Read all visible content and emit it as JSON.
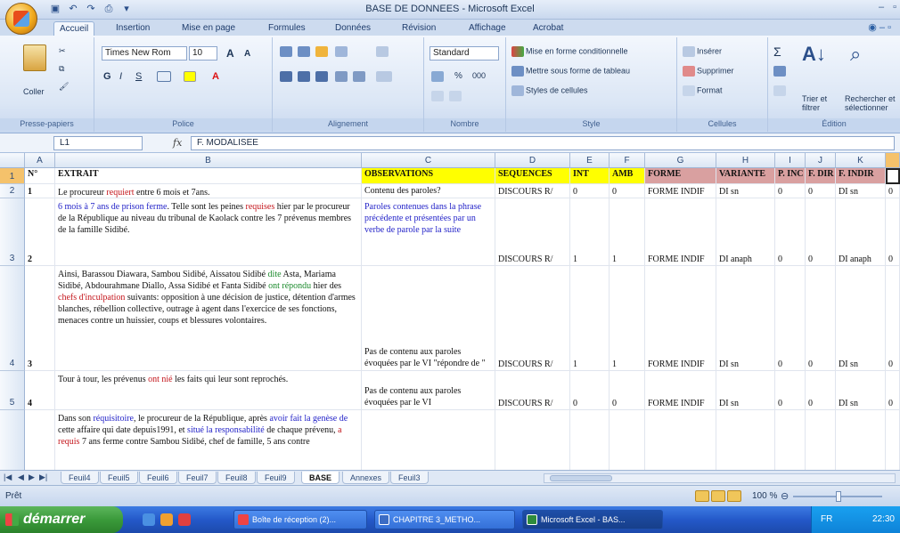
{
  "window": {
    "title": "BASE DE DONNEES - Microsoft Excel",
    "controls": [
      "–",
      "▫",
      "✕"
    ]
  },
  "ribbon": {
    "tabs": [
      "Accueil",
      "Insertion",
      "Mise en page",
      "Formules",
      "Données",
      "Révision",
      "Affichage",
      "Acrobat"
    ],
    "active_tab": "Accueil",
    "groups": {
      "clipboard": {
        "label": "Presse-papiers",
        "paste": "Coller"
      },
      "font": {
        "label": "Police",
        "name": "Times New Rom",
        "size": "10",
        "grow": "A",
        "shrink": "A",
        "bold": "G",
        "italic": "I",
        "underline": "S"
      },
      "alignment": {
        "label": "Alignement"
      },
      "number": {
        "label": "Nombre",
        "format": "Standard",
        "percent": "%",
        "thousands": "000"
      },
      "style": {
        "label": "Style",
        "conditional": "Mise en forme conditionnelle",
        "as_table": "Mettre sous forme de tableau",
        "cell_styles": "Styles de cellules"
      },
      "cells": {
        "label": "Cellules",
        "insert": "Insérer",
        "delete": "Supprimer",
        "format": "Format"
      },
      "editing": {
        "label": "Édition",
        "sigma": "Σ",
        "sort": "Trier et filtrer",
        "find": "Rechercher et sélectionner"
      }
    }
  },
  "formula_bar": {
    "name_box": "L1",
    "fx": "fx",
    "content": "F. MODALISEE"
  },
  "columns": [
    "A",
    "B",
    "C",
    "D",
    "E",
    "F",
    "G",
    "H",
    "I",
    "J",
    "K"
  ],
  "table": {
    "header": [
      "N°",
      "EXTRAIT",
      "OBSERVATIONS",
      "SEQUENCES",
      "INT",
      "AMB",
      "FORME",
      "VARIANTE",
      "P. INC",
      "F. DIR",
      "F. INDIR"
    ],
    "rows": [
      {
        "rownum": "2",
        "n": "1",
        "extrait_html": "Le procureur <span class=\"red\">requiert</span> entre 6 mois et 7ans.",
        "obs": "Contenu des paroles?",
        "seq": "DISCOURS R/",
        "int": "0",
        "amb": "0",
        "forme": "FORME INDIF",
        "variante": "DI sn",
        "pinc": "0",
        "fdir": "0",
        "findir": "DI sn",
        "l": "0"
      },
      {
        "rownum": "3",
        "n": "2",
        "extrait_html": "<span class=\"blue\">6 mois à 7 ans de prison ferme</span>. Telle sont les peines <span class=\"red\">requises</span> hier par le procureur de la République au niveau du tribunal de Kaolack contre les 7 prévenus membres de la famille Sidibé.",
        "obs_html": "<span class=\"blue\">Paroles contenues dans la phrase précédente et présentées par un verbe de parole par la suite</span>",
        "seq": "DISCOURS R/",
        "int": "1",
        "amb": "1",
        "forme": "FORME INDIF",
        "variante": "DI anaph",
        "pinc": "0",
        "fdir": "0",
        "findir": "DI anaph",
        "l": "0"
      },
      {
        "rownum": "4",
        "n": "3",
        "extrait_html": "Ainsi, Barassou Diawara, Sambou Sidibé, Aissatou Sidibé <span class=\"green\">dite</span> Asta, Mariama Sidibé, Abdourahmane Diallo, Assa Sidibé et Fanta Sidibé <span class=\"green\">ont répondu</span> hier des <span class=\"red\">chefs d'inculpation</span> suivants: opposition à une décision de justice, détention d'armes blanches, rébellion collective, outrage à agent dans l'exercice de ses fonctions, menaces contre un huissier, coups et blessures volontaires.",
        "obs": "Pas de contenu aux paroles évoquées par le VI \"répondre de \"",
        "seq": "DISCOURS R/",
        "int": "1",
        "amb": "1",
        "forme": "FORME INDIF",
        "variante": "DI sn",
        "pinc": "0",
        "fdir": "0",
        "findir": "DI sn",
        "l": "0"
      },
      {
        "rownum": "5",
        "n": "4",
        "extrait_html": "Tour à tour, les prévenus <span class=\"red\">ont nié</span> les faits qui leur sont reprochés.",
        "obs": "Pas de contenu aux paroles évoquées par le VI",
        "seq": "DISCOURS R/",
        "int": "0",
        "amb": "0",
        "forme": "FORME INDIF",
        "variante": "DI sn",
        "pinc": "0",
        "fdir": "0",
        "findir": "DI sn",
        "l": "0"
      },
      {
        "rownum": "",
        "n": "",
        "extrait_html": "Dans son <span class=\"blue\">réquisitoire</span>, le procureur de la République, après <span class=\"blue\">avoir fait la genèse de</span> cette affaire qui date depuis1991, et <span class=\"blue\">situé la responsabilité</span> de chaque prévenu, <span class=\"red\">a requis</span> 7 ans ferme contre Sambou Sidibé, chef de famille, 5 ans contre",
        "obs": "",
        "seq": "",
        "int": "",
        "amb": "",
        "forme": "",
        "variante": "",
        "pinc": "",
        "fdir": "",
        "findir": "",
        "l": ""
      }
    ]
  },
  "sheets": [
    "Feuil4",
    "Feuil5",
    "Feuil6",
    "Feuil7",
    "Feuil8",
    "Feuil9",
    "BASE",
    "Annexes",
    "Feuil3"
  ],
  "active_sheet": "BASE",
  "status": {
    "ready": "Prêt",
    "zoom": "100 %"
  },
  "taskbar": {
    "start": "démarrer",
    "tasks": [
      "Boîte de réception (2)...",
      "CHAPITRE 3_METHO...",
      "Microsoft Excel - BAS..."
    ],
    "active_task": "Microsoft Excel - BAS...",
    "lang": "FR",
    "clock": "22:30"
  },
  "colors": {
    "header_yellow": "#ffff00",
    "header_pink": "#d9a0a0",
    "accent": "#2b5797"
  }
}
